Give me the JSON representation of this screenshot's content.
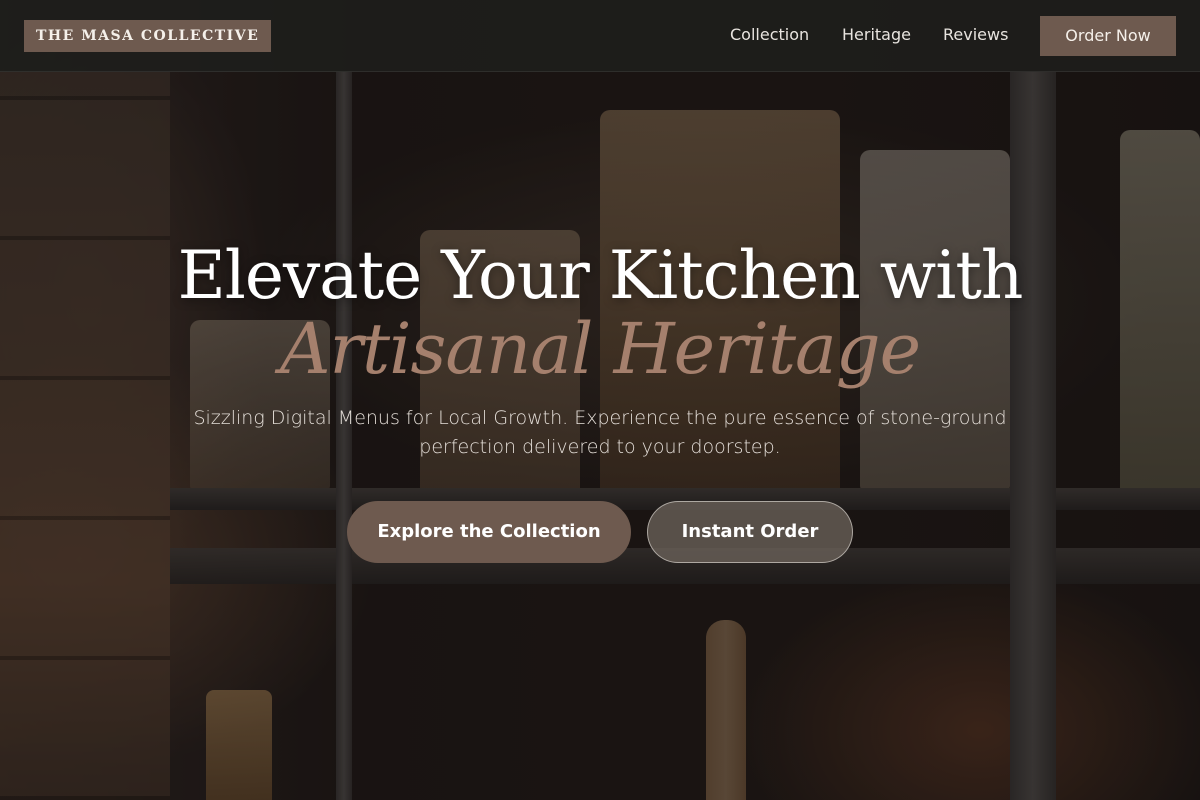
{
  "header": {
    "logo": "THE MASA COLLECTIVE",
    "nav": [
      {
        "label": "Collection"
      },
      {
        "label": "Heritage"
      },
      {
        "label": "Reviews"
      }
    ],
    "cta_label": "Order Now"
  },
  "hero": {
    "title": "Elevate Your Kitchen with",
    "accent": "Artisanal Heritage",
    "subtitle": "Sizzling Digital Menus for Local Growth. Experience the pure essence of stone-ground perfection delivered to your doorstep.",
    "primary_button": "Explore the Collection",
    "secondary_button": "Instant Order"
  },
  "colors": {
    "brand": "#6e5a4f",
    "accent_text": "#a5806d",
    "header_bg": "#1e1e1c"
  }
}
